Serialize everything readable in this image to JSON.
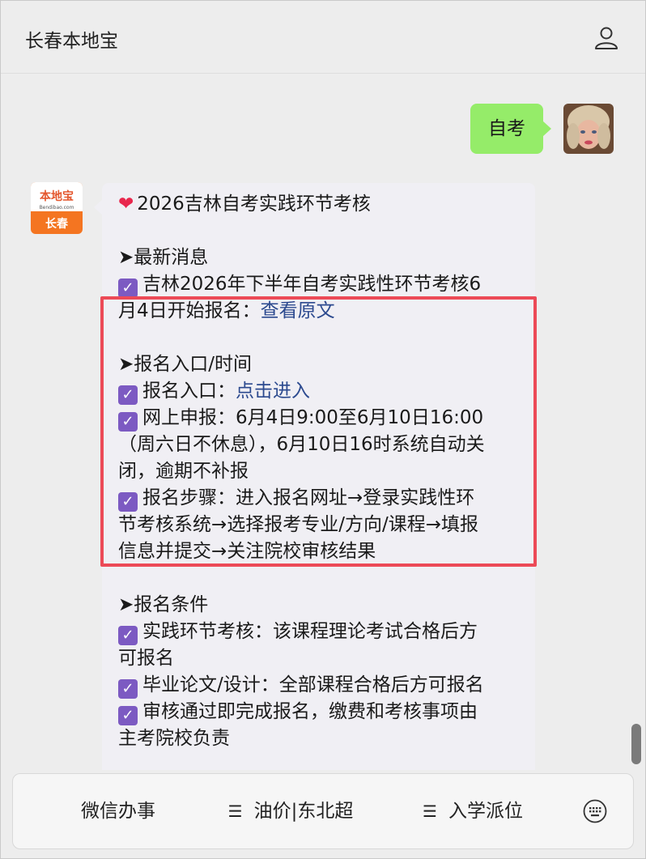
{
  "app": {
    "title": "长春本地宝"
  },
  "chat": {
    "user_message": "自考",
    "bot_logo": {
      "brand": "本地宝",
      "domain": "Bendibao.com",
      "city": "长春"
    },
    "bot_message": {
      "title": "2026吉林自考实践环节考核",
      "sections": [
        {
          "heading": "➤最新消息",
          "line1": "吉林2026年下半年自考实践性环节考核6",
          "line2_prefix": "月4日开始报名：",
          "link": "查看原文"
        },
        {
          "heading": "➤报名入口/时间",
          "entry_prefix": "报名入口：",
          "entry_link": "点击进入",
          "online_l1": "网上申报：6月4日9:00至6月10日16:00",
          "online_l2": "（周六日不休息），6月10日16时系统自动关",
          "online_l3": "闭，逾期不补报",
          "steps_l1": "报名步骤：进入报名网址→登录实践性环",
          "steps_l2": "节考核系统→选择报考专业/方向/课程→填报",
          "steps_l3": "信息并提交→关注院校审核结果"
        },
        {
          "heading": "➤报名条件",
          "c1_l1": "实践环节考核：该课程理论考试合格后方",
          "c1_l2": "可报名",
          "c2": "毕业论文/设计：全部课程合格后方可报名",
          "c3_l1": "审核通过即完成报名，缴费和考核事项由",
          "c3_l2": "主考院校负责"
        }
      ]
    }
  },
  "bottom_menu": {
    "item1": "微信办事",
    "item2": "油价|东北超",
    "item3": "入学派位"
  },
  "icons": {
    "user": "user-icon",
    "check": "checkbox-checked-icon",
    "heart": "heart-icon",
    "menu": "menu-icon",
    "keyboard": "keyboard-icon"
  },
  "colors": {
    "bubble_green": "#95ec69",
    "link": "#2c4a8f",
    "highlight": "#ec4a57",
    "check": "#7c5ac2"
  }
}
